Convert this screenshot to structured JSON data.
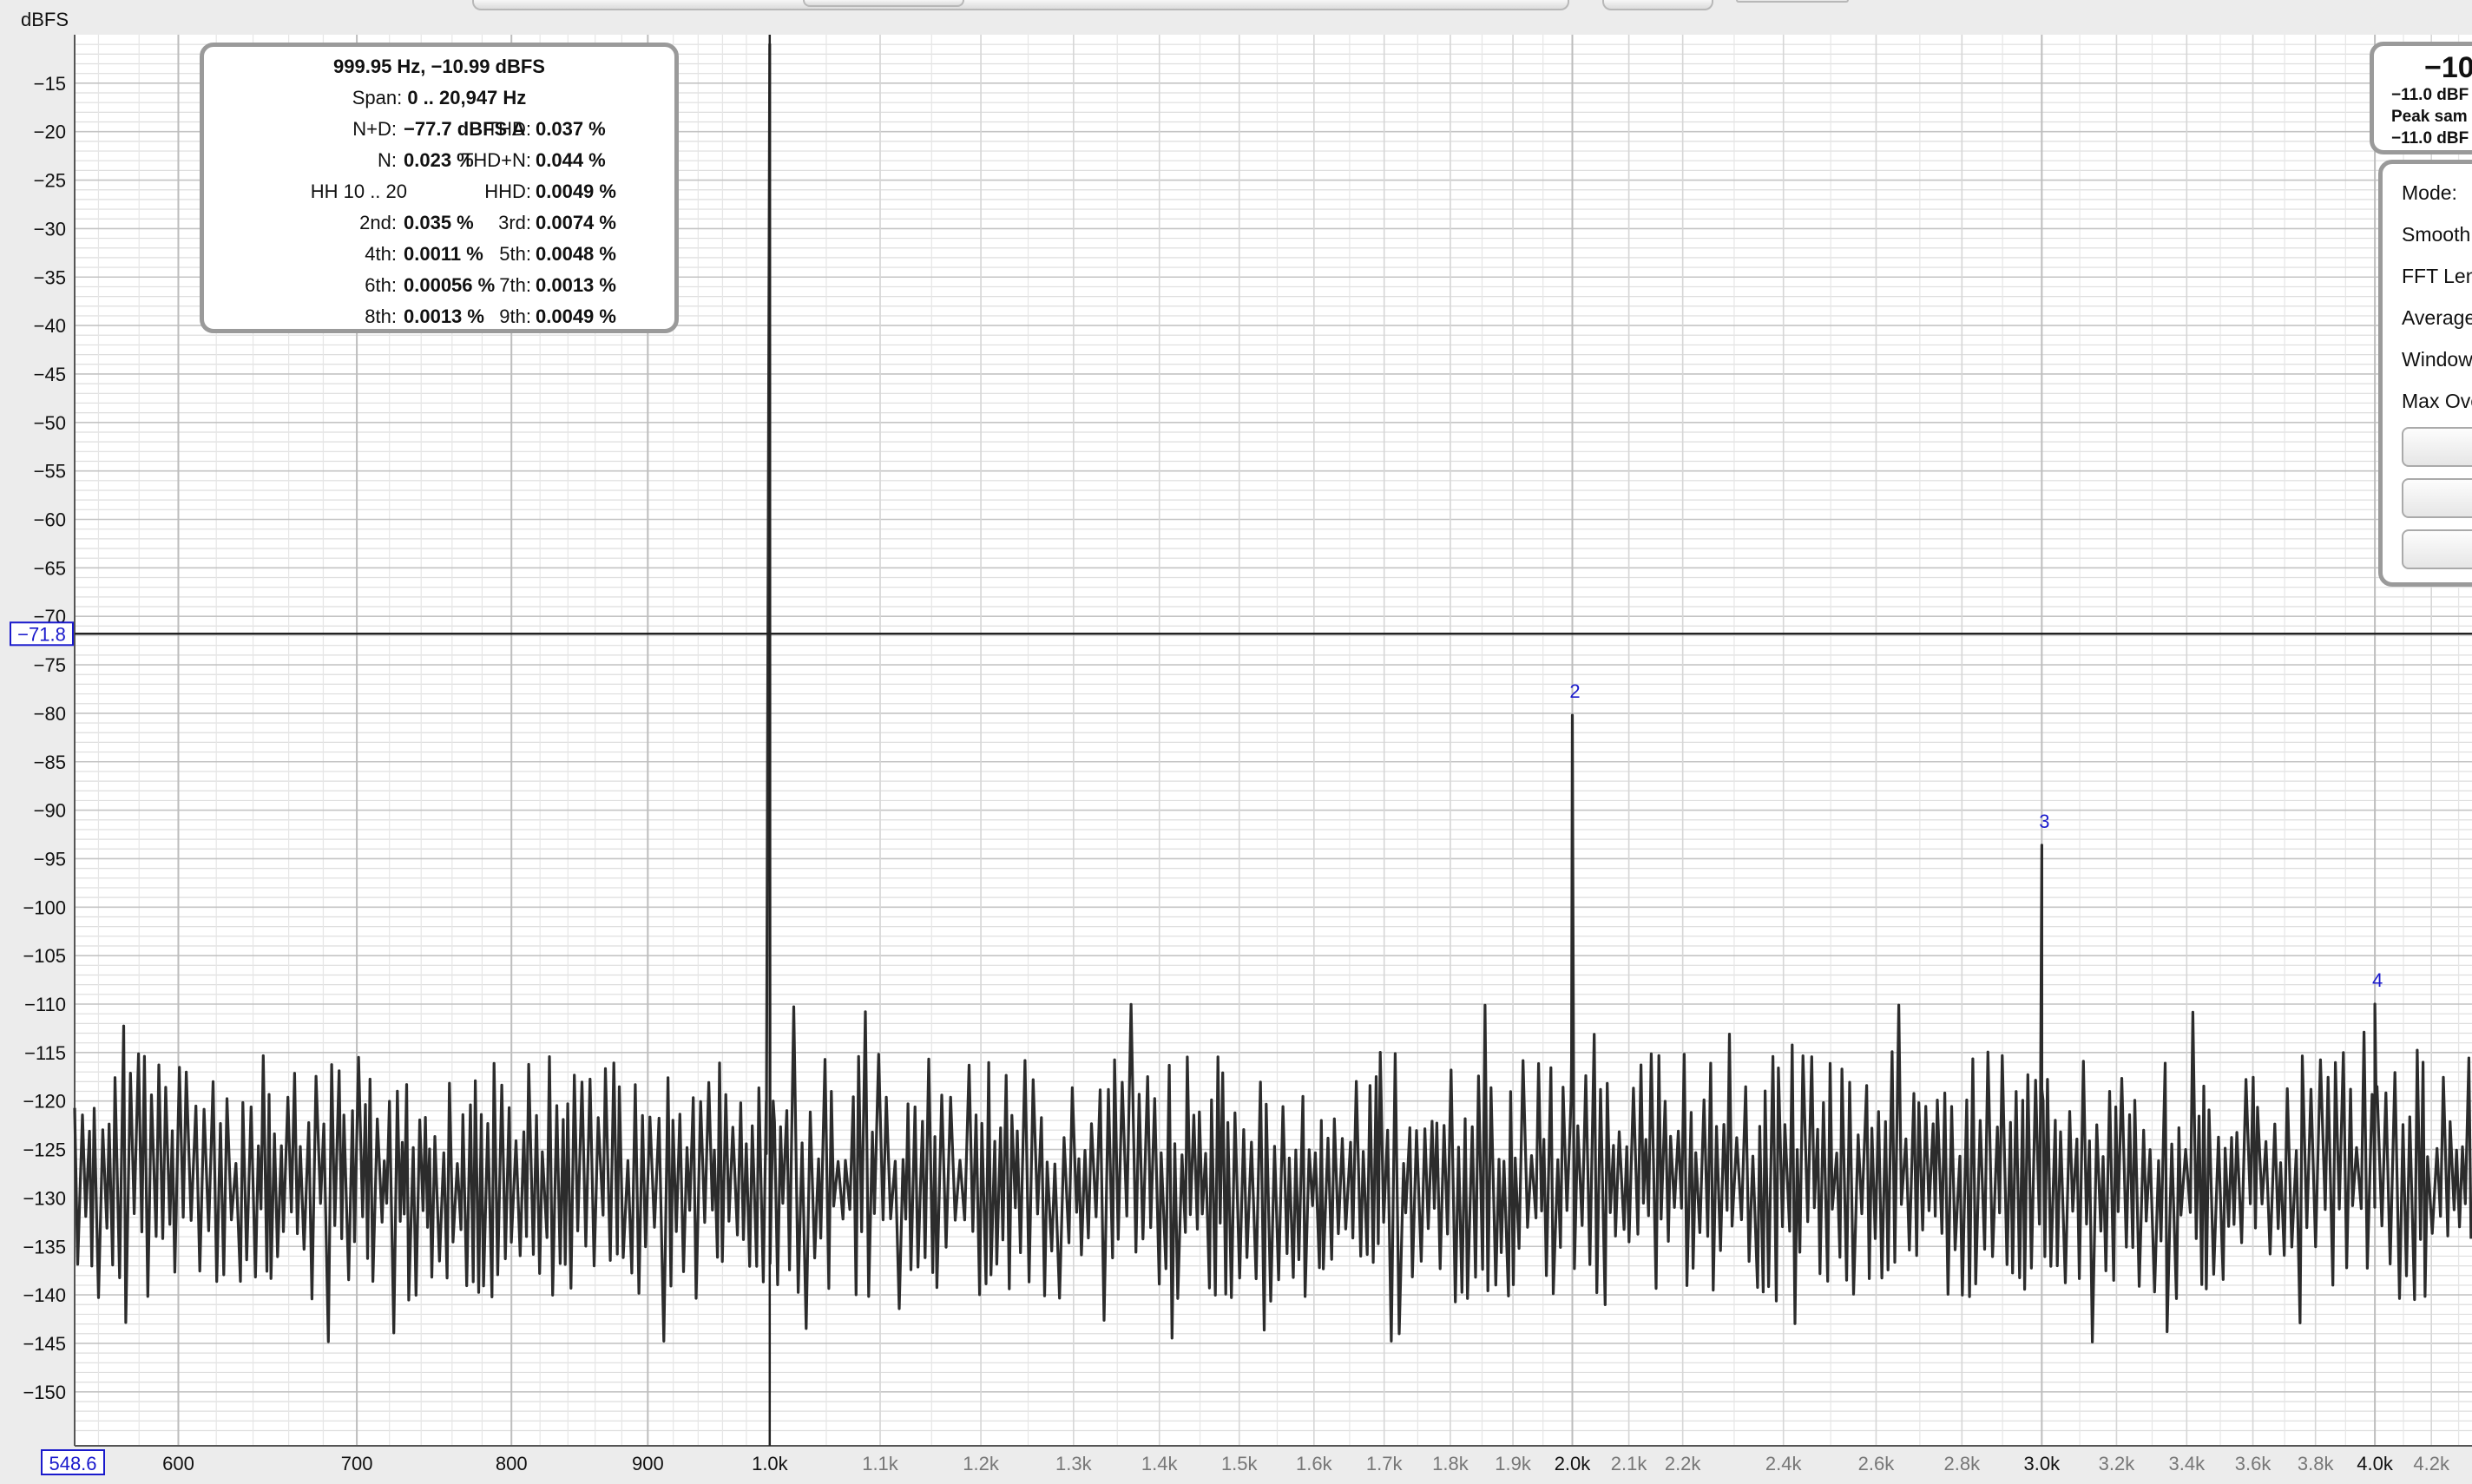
{
  "chart_data": {
    "type": "line",
    "title": "",
    "xlabel": "",
    "ylabel": "dBFS",
    "xscale": "log",
    "xlim": [
      548.6,
      4350
    ],
    "ylim": [
      -155,
      -10
    ],
    "yticks": [
      -15,
      -20,
      -25,
      -30,
      -35,
      -40,
      -45,
      -50,
      -55,
      -60,
      -65,
      -70,
      -75,
      -80,
      -85,
      -90,
      -95,
      -100,
      -105,
      -110,
      -115,
      -120,
      -125,
      -130,
      -135,
      -140,
      -145,
      -150
    ],
    "major_xticks": [
      {
        "v": 600,
        "label": "600"
      },
      {
        "v": 700,
        "label": "700"
      },
      {
        "v": 800,
        "label": "800"
      },
      {
        "v": 900,
        "label": "900"
      },
      {
        "v": 1000,
        "label": "1.0k"
      },
      {
        "v": 2000,
        "label": "2.0k"
      },
      {
        "v": 3000,
        "label": "3.0k"
      },
      {
        "v": 4000,
        "label": "4.0k"
      }
    ],
    "minor_xticks": [
      {
        "v": 1100,
        "label": "1.1k"
      },
      {
        "v": 1200,
        "label": "1.2k"
      },
      {
        "v": 1300,
        "label": "1.3k"
      },
      {
        "v": 1400,
        "label": "1.4k"
      },
      {
        "v": 1500,
        "label": "1.5k"
      },
      {
        "v": 1600,
        "label": "1.6k"
      },
      {
        "v": 1700,
        "label": "1.7k"
      },
      {
        "v": 1800,
        "label": "1.8k"
      },
      {
        "v": 1900,
        "label": "1.9k"
      },
      {
        "v": 2100,
        "label": "2.1k"
      },
      {
        "v": 2200,
        "label": "2.2k"
      },
      {
        "v": 2400,
        "label": "2.4k"
      },
      {
        "v": 2600,
        "label": "2.6k"
      },
      {
        "v": 2800,
        "label": "2.8k"
      },
      {
        "v": 3200,
        "label": "3.2k"
      },
      {
        "v": 3400,
        "label": "3.4k"
      },
      {
        "v": 3600,
        "label": "3.6k"
      },
      {
        "v": 3800,
        "label": "3.8k"
      },
      {
        "v": 4200,
        "label": "4.2k"
      }
    ],
    "cursor": {
      "y": -71.8,
      "y_label": "−71.8",
      "x": 548.6,
      "x_label": "548.6"
    },
    "noise_floor": {
      "mean": -128.5,
      "min": -145,
      "max": -110
    },
    "peaks": [
      {
        "x": 999.95,
        "y": -10.99,
        "label": ""
      },
      {
        "x": 2000,
        "y": -80.2,
        "label": "2"
      },
      {
        "x": 3000,
        "y": -93.6,
        "label": "3"
      },
      {
        "x": 4000,
        "y": -110.0,
        "label": "4"
      }
    ],
    "colors": {
      "trace": "#2c2c2c",
      "harmonic_label": "#1a1acc",
      "grid_major": "#c4c4c4",
      "grid_minor": "#dedede",
      "cursor_box": "#1a1acc"
    }
  },
  "info": {
    "header": "999.95 Hz, −10.99 dBFS",
    "span_label": "Span:",
    "span_value": "0 .. 20,947 Hz",
    "nd_label": "N+D:",
    "nd_value": "−77.7 dBFS A",
    "thd_label": "THD:",
    "thd_value": "0.037 %",
    "n_label": "N:",
    "n_value": "0.023 %",
    "thdn_label": "THD+N:",
    "thdn_value": "0.044 %",
    "hh_label": "HH 10 .. 20",
    "hhd_label": "HHD:",
    "hhd_value": "0.0049 %",
    "h2_label": "2nd:",
    "h2_value": "0.035 %",
    "h3_label": "3rd:",
    "h3_value": "0.0074 %",
    "h4_label": "4th:",
    "h4_value": "0.0011 %",
    "h5_label": "5th:",
    "h5_value": "0.0048 %",
    "h6_label": "6th:",
    "h6_value": "0.00056 %",
    "h7_label": "7th:",
    "h7_value": "0.0013 %",
    "h8_label": "8th:",
    "h8_value": "0.0013 %",
    "h9_label": "9th:",
    "h9_value": "0.0049 %"
  },
  "level_box": {
    "big": "−10",
    "line1": "−11.0 dBF",
    "line2": "Peak sam",
    "line3": "−11.0 dBF"
  },
  "controls": {
    "mode": "Mode:",
    "smooth": "Smooth",
    "fft_length": "FFT Leng",
    "average": "Average",
    "window": "Window",
    "max_overlap": "Max Ove"
  }
}
